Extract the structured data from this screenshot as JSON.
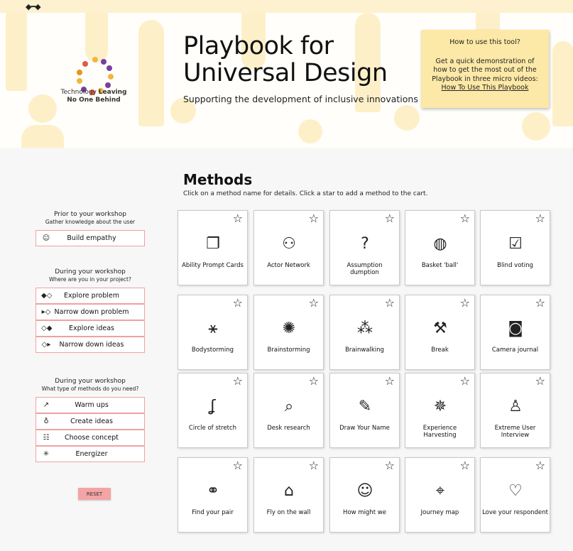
{
  "topbar": {
    "mini_icon": "arrows-icon"
  },
  "header": {
    "logo_text_pre": "Technology ",
    "logo_text_bold1": "Leaving",
    "logo_text_bold2": "No One Behind",
    "title_line1": "Playbook for",
    "title_line2": "Universal Design",
    "subtitle": "Supporting the development of inclusive innovations",
    "howto": {
      "title": "How to use this tool?",
      "body": "Get a quick demonstration of how to get the most out of the Playbook in three micro videos: ",
      "link": "How To Use This Playbook"
    }
  },
  "main": {
    "heading": "Methods",
    "instruction": "Click on a method name for details. Click a star to add a method to the cart."
  },
  "sidebar": {
    "section1": {
      "title": "Prior to your workshop",
      "subtitle": "Gather knowledge about the user",
      "items": [
        {
          "label": "Build empathy",
          "icon": "head-icon"
        }
      ]
    },
    "section2": {
      "title": "During your workshop",
      "subtitle": "Where are you in your project?",
      "items": [
        {
          "label": "Explore problem",
          "icon": "explore-problem-icon"
        },
        {
          "label": "Narrow down problem",
          "icon": "narrow-problem-icon"
        },
        {
          "label": "Explore ideas",
          "icon": "explore-ideas-icon"
        },
        {
          "label": "Narrow down ideas",
          "icon": "narrow-ideas-icon"
        }
      ]
    },
    "section3": {
      "title": "During your workshop",
      "subtitle": "What type of methods do you need?",
      "items": [
        {
          "label": "Warm ups",
          "icon": "trend-icon"
        },
        {
          "label": "Create ideas",
          "icon": "bulb-icon"
        },
        {
          "label": "Choose concept",
          "icon": "checklist-icon"
        },
        {
          "label": "Energizer",
          "icon": "spark-icon"
        }
      ]
    },
    "reset_label": "RESET"
  },
  "methods": [
    {
      "name": "Ability Prompt Cards",
      "icon": "cards-icon"
    },
    {
      "name": "Actor Network",
      "icon": "network-icon"
    },
    {
      "name": "Assumption dumption",
      "icon": "question-person-icon"
    },
    {
      "name": "Basket 'ball'",
      "icon": "ball-icon"
    },
    {
      "name": "Blind voting",
      "icon": "vote-icon"
    },
    {
      "name": "Bodystorming",
      "icon": "body-icon"
    },
    {
      "name": "Brainstorming",
      "icon": "brain-bulb-icon"
    },
    {
      "name": "Brainwalking",
      "icon": "ideas-circle-icon"
    },
    {
      "name": "Break",
      "icon": "hammer-icon"
    },
    {
      "name": "Camera journal",
      "icon": "camera-icon"
    },
    {
      "name": "Circle of stretch",
      "icon": "stretch-icon"
    },
    {
      "name": "Desk research",
      "icon": "research-icon"
    },
    {
      "name": "Draw Your Name",
      "icon": "id-pencil-icon"
    },
    {
      "name": "Experience Harvesting",
      "icon": "harvest-icon"
    },
    {
      "name": "Extreme User Interview",
      "icon": "interview-icon"
    },
    {
      "name": "Find your pair",
      "icon": "pair-icon"
    },
    {
      "name": "Fly on the wall",
      "icon": "fly-icon"
    },
    {
      "name": "How might we",
      "icon": "thinker-icon"
    },
    {
      "name": "Journey map",
      "icon": "map-pin-icon"
    },
    {
      "name": "Love your respondent",
      "icon": "heart-hands-icon"
    }
  ],
  "colors": {
    "accent_pink": "#f0a1a1",
    "reset_pink": "#f4a4a4",
    "note_yellow": "#fce9a7",
    "hero_bg": "#fdf0c8"
  }
}
